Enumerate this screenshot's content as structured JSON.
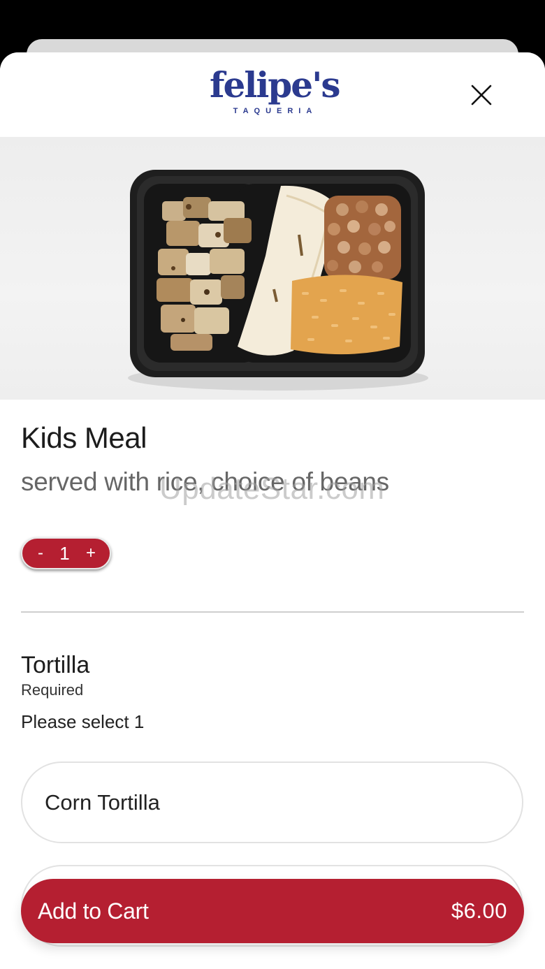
{
  "brand": {
    "name": "felipe's",
    "subtitle": "TAQUERIA",
    "color": "#2b3a8f"
  },
  "accent_color": "#b51f31",
  "close_icon": "close-icon",
  "item": {
    "title": "Kids Meal",
    "description": "served with rice, choice of beans",
    "watermark": "UpdateStar.com"
  },
  "quantity": {
    "minus_label": "-",
    "value": "1",
    "plus_label": "+"
  },
  "modifier_group": {
    "title": "Tortilla",
    "required": "Required",
    "instruction": "Please select 1",
    "options": [
      {
        "label": "Corn Tortilla"
      },
      {
        "label": ""
      }
    ]
  },
  "cart": {
    "add_label": "Add to Cart",
    "price": "$6.00"
  }
}
